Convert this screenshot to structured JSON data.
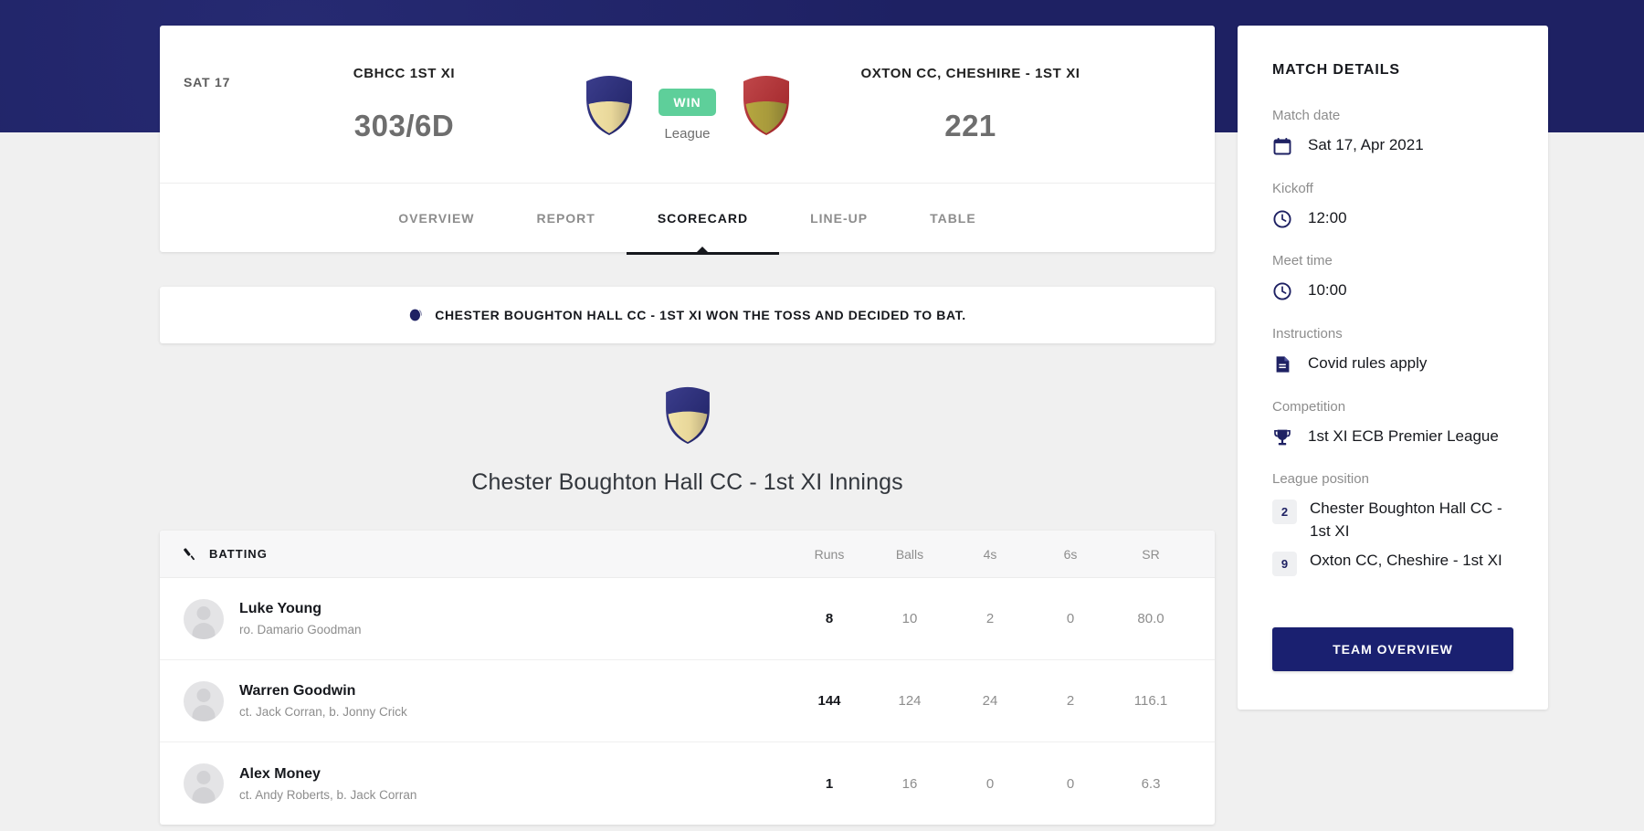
{
  "header": {
    "date_label": "SAT 17",
    "home": {
      "name": "CBHCC 1ST XI",
      "score": "303/6D",
      "crest": "navy-shield-crest"
    },
    "away": {
      "name": "OXTON CC, CHESHIRE - 1ST XI",
      "score": "221",
      "crest": "red-shield-crest"
    },
    "result_badge": "WIN",
    "competition_type": "League",
    "result_color": "#5ecf9a"
  },
  "tabs": [
    {
      "label": "OVERVIEW",
      "active": false
    },
    {
      "label": "REPORT",
      "active": false
    },
    {
      "label": "SCORECARD",
      "active": true
    },
    {
      "label": "LINE-UP",
      "active": false
    },
    {
      "label": "TABLE",
      "active": false
    }
  ],
  "toss": {
    "icon": "cricket-ball-icon",
    "text": "CHESTER BOUGHTON HALL CC - 1ST XI WON THE TOSS AND DECIDED TO BAT."
  },
  "innings": {
    "crest": "navy-shield-crest",
    "title": "Chester Boughton Hall CC - 1st XI Innings"
  },
  "batting": {
    "section_icon": "cricket-bat-icon",
    "section_label": "BATTING",
    "columns": [
      "Runs",
      "Balls",
      "4s",
      "6s",
      "SR"
    ],
    "rows": [
      {
        "name": "Luke Young",
        "dismissal": "ro. Damario Goodman",
        "runs": "8",
        "balls": "10",
        "fours": "2",
        "sixes": "0",
        "sr": "80.0"
      },
      {
        "name": "Warren Goodwin",
        "dismissal": "ct. Jack Corran, b. Jonny Crick",
        "runs": "144",
        "balls": "124",
        "fours": "24",
        "sixes": "2",
        "sr": "116.1"
      },
      {
        "name": "Alex Money",
        "dismissal": "ct. Andy Roberts, b. Jack Corran",
        "runs": "1",
        "balls": "16",
        "fours": "0",
        "sixes": "0",
        "sr": "6.3"
      }
    ]
  },
  "sidebar": {
    "title": "MATCH DETAILS",
    "fields": [
      {
        "label": "Match date",
        "icon": "calendar-icon",
        "value": "Sat 17, Apr 2021"
      },
      {
        "label": "Kickoff",
        "icon": "clock-icon",
        "value": "12:00"
      },
      {
        "label": "Meet time",
        "icon": "clock-icon",
        "value": "10:00"
      },
      {
        "label": "Instructions",
        "icon": "document-icon",
        "value": "Covid rules apply"
      },
      {
        "label": "Competition",
        "icon": "trophy-icon",
        "value": "1st XI ECB Premier League"
      }
    ],
    "league_position": {
      "label": "League position",
      "entries": [
        {
          "position": "2",
          "team": "Chester Boughton Hall CC - 1st XI"
        },
        {
          "position": "9",
          "team": "Oxton CC, Cheshire - 1st XI"
        }
      ]
    },
    "button_label": "TEAM OVERVIEW",
    "brand_navy": "#1a2070"
  }
}
